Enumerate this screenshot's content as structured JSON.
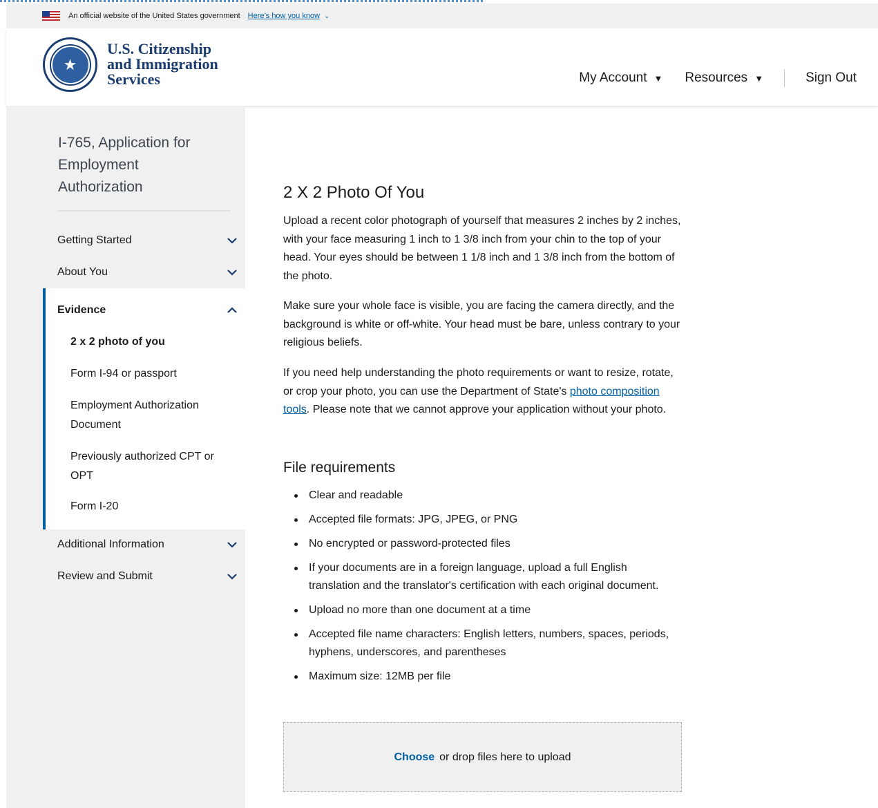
{
  "gov_banner": {
    "text": "An official website of the United States government",
    "link": "Here’s how you know"
  },
  "header": {
    "agency_line1": "U.S. Citizenship",
    "agency_line2": "and Immigration",
    "agency_line3": "Services",
    "nav": {
      "my_account": "My Account",
      "resources": "Resources",
      "sign_out": "Sign Out"
    }
  },
  "sidebar": {
    "form_title": "I-765, Application for Employment Authorization",
    "sections": [
      {
        "label": "Getting Started"
      },
      {
        "label": "About You"
      },
      {
        "label": "Evidence"
      },
      {
        "label": "Additional Information"
      },
      {
        "label": "Review and Submit"
      }
    ],
    "evidence_items": [
      "2 x 2 photo of you",
      "Form I-94 or passport",
      "Employment Authorization Document",
      "Previously authorized CPT or OPT",
      "Form I-20"
    ]
  },
  "main": {
    "title": "2 X 2 Photo Of You",
    "para1": "Upload a recent color photograph of yourself that measures 2 inches by 2 inches, with your face measuring 1 inch to 1 3/8 inch from your chin to the top of your head. Your eyes should be between 1 1/8 inch and 1 3/8 inch from the bottom of the photo.",
    "para2": "Make sure your whole face is visible, you are facing the camera directly, and the background is white or off-white. Your head must be bare, unless contrary to your religious beliefs.",
    "para3_before": "If you need help understanding the photo requirements or want to resize, rotate, or crop your photo, you can use the Department of State's ",
    "para3_link": "photo composition tools",
    "para3_after": ". Please note that we cannot approve your application without your photo.",
    "file_req_title": "File requirements",
    "file_requirements": [
      "Clear and readable",
      "Accepted file formats: JPG, JPEG, or PNG",
      "No encrypted or password-protected files",
      "If your documents are in a foreign language, upload a full English translation and the translator's certification with each original document.",
      "Upload no more than one document at a time",
      "Accepted file name characters: English letters, numbers, spaces, periods, hyphens, underscores, and parentheses",
      "Maximum size: 12MB per file"
    ],
    "upload": {
      "choose": "Choose",
      "rest": "or drop files here to upload"
    }
  }
}
